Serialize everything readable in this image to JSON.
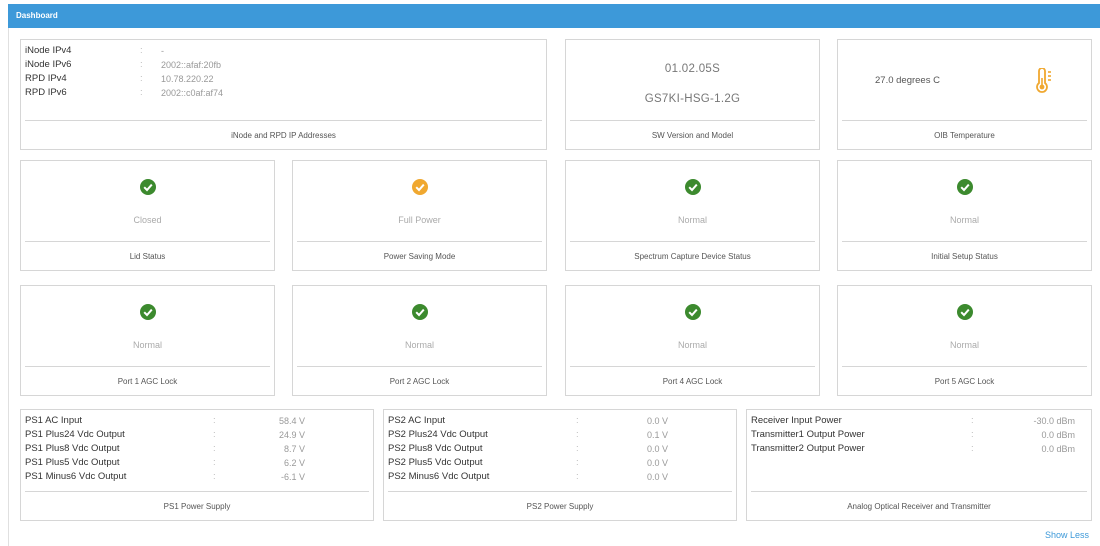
{
  "header": {
    "title": "Dashboard"
  },
  "ip_card": {
    "rows": [
      {
        "label": "iNode IPv4",
        "sep": ":",
        "value": "-"
      },
      {
        "label": "iNode IPv6",
        "sep": ":",
        "value": "2002::afaf:20fb"
      },
      {
        "label": "RPD IPv4",
        "sep": ":",
        "value": "10.78.220.22"
      },
      {
        "label": "RPD IPv6",
        "sep": ":",
        "value": "2002::c0af:af74"
      }
    ],
    "footer": "iNode and RPD IP Addresses"
  },
  "sw_card": {
    "version": "01.02.05S",
    "model": "GS7KI-HSG-1.2G",
    "footer": "SW Version and Model"
  },
  "temp_card": {
    "value": "27.0 degrees C",
    "icon": "thermometer-icon",
    "footer": "OIB Temperature"
  },
  "status_cards_row1": [
    {
      "status": "Closed",
      "footer": "Lid Status",
      "state": "ok"
    },
    {
      "status": "Full Power",
      "footer": "Power Saving Mode",
      "state": "warn"
    },
    {
      "status": "Normal",
      "footer": "Spectrum Capture Device Status",
      "state": "ok"
    },
    {
      "status": "Normal",
      "footer": "Initial Setup Status",
      "state": "ok"
    }
  ],
  "status_cards_row2": [
    {
      "status": "Normal",
      "footer": "Port 1 AGC Lock",
      "state": "ok"
    },
    {
      "status": "Normal",
      "footer": "Port 2 AGC Lock",
      "state": "ok"
    },
    {
      "status": "Normal",
      "footer": "Port 4 AGC Lock",
      "state": "ok"
    },
    {
      "status": "Normal",
      "footer": "Port 5 AGC Lock",
      "state": "ok"
    }
  ],
  "ps1": {
    "rows": [
      {
        "label": "PS1 AC Input",
        "sep": ":",
        "value": "58.4 V"
      },
      {
        "label": "PS1 Plus24 Vdc Output",
        "sep": ":",
        "value": "24.9 V"
      },
      {
        "label": "PS1 Plus8 Vdc Output",
        "sep": ":",
        "value": "8.7 V"
      },
      {
        "label": "PS1 Plus5 Vdc Output",
        "sep": ":",
        "value": "6.2 V"
      },
      {
        "label": "PS1 Minus6 Vdc Output",
        "sep": ":",
        "value": "-6.1 V"
      }
    ],
    "footer": "PS1 Power Supply"
  },
  "ps2": {
    "rows": [
      {
        "label": "PS2 AC Input",
        "sep": ":",
        "value": "0.0 V"
      },
      {
        "label": "PS2 Plus24 Vdc Output",
        "sep": ":",
        "value": "0.1 V"
      },
      {
        "label": "PS2 Plus8 Vdc Output",
        "sep": ":",
        "value": "0.0 V"
      },
      {
        "label": "PS2 Plus5 Vdc Output",
        "sep": ":",
        "value": "0.0 V"
      },
      {
        "label": "PS2 Minus6 Vdc Output",
        "sep": ":",
        "value": "0.0 V"
      }
    ],
    "footer": "PS2 Power Supply"
  },
  "optical": {
    "rows": [
      {
        "label": "Receiver Input Power",
        "sep": ":",
        "value": "-30.0 dBm"
      },
      {
        "label": "Transmitter1 Output Power",
        "sep": ":",
        "value": "0.0 dBm"
      },
      {
        "label": "Transmitter2 Output Power",
        "sep": ":",
        "value": "0.0 dBm"
      }
    ],
    "footer": "Analog Optical Receiver and Transmitter"
  },
  "show_less": "Show Less",
  "colors": {
    "header": "#3d99d9",
    "ok": "#3c8a2e",
    "warn": "#f0a830"
  }
}
